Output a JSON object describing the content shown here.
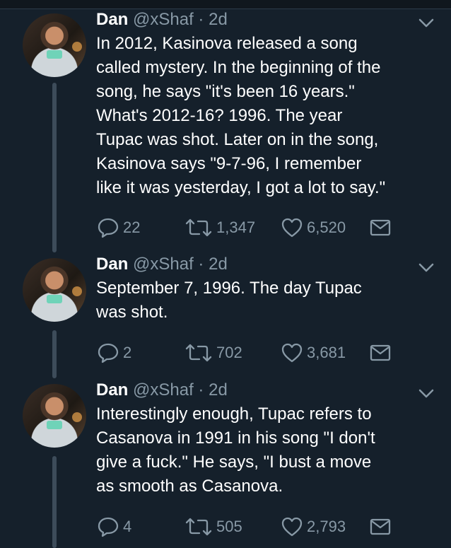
{
  "tweets": [
    {
      "name": "Dan",
      "handle": "@xShaf",
      "separator": "·",
      "time": "2d",
      "text": "In 2012, Kasinova released a song\ncalled mystery. In the beginning of the\nsong, he says \"it's been 16 years.\"\nWhat's 2012-16? 1996. The year\nTupac was shot. Later on in the song,\nKasinova says \"9-7-96, I remember\nlike it was yesterday, I got a lot to say.\"",
      "replies": "22",
      "retweets": "1,347",
      "likes": "6,520"
    },
    {
      "name": "Dan",
      "handle": "@xShaf",
      "separator": "·",
      "time": "2d",
      "text": "September 7, 1996. The day Tupac\nwas shot.",
      "replies": "2",
      "retweets": "702",
      "likes": "3,681"
    },
    {
      "name": "Dan",
      "handle": "@xShaf",
      "separator": "·",
      "time": "2d",
      "text": "Interestingly enough, Tupac refers to\nCasanova in 1991 in his song \"I don't\ngive a fuck.\" He says, \"I bust a move\nas smooth as Casanova.",
      "replies": "4",
      "retweets": "505",
      "likes": "2,793"
    }
  ],
  "icons": {
    "reply": "reply-icon",
    "retweet": "retweet-icon",
    "like": "heart-icon",
    "share": "envelope-icon",
    "menu": "chevron-down-icon"
  },
  "colors": {
    "background": "#15202b",
    "muted": "#8899a6",
    "text": "#ffffff",
    "thread_line": "#3d4c5a"
  }
}
